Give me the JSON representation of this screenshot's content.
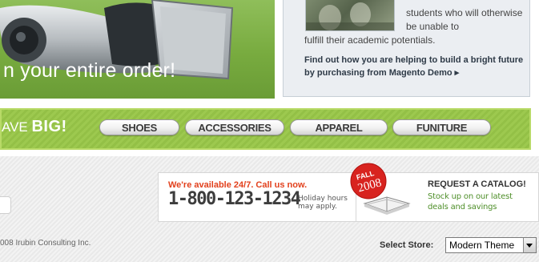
{
  "promo_left": {
    "headline": "n your entire order!"
  },
  "promo_right": {
    "desc_line1": "students who will otherwise be unable to",
    "desc_line2": "fulfill their academic potentials.",
    "cta": "Find out how you are helping to build a bright future by purchasing from Magento Demo ▸"
  },
  "nav": {
    "slogan_prefix": "AVE ",
    "slogan_big": "BIG!",
    "buttons": [
      {
        "label": "SHOES"
      },
      {
        "label": "ACCESSORIES"
      },
      {
        "label": "APPAREL"
      },
      {
        "label": "FUNITURE"
      }
    ]
  },
  "footer": {
    "availability": "We're available 24/7. Call us now.",
    "phone": "1-800-123-1234",
    "hours_note": "Holiday hours may apply.",
    "badge_top": "FALL",
    "badge_year": "2008",
    "catalog_title": "REQUEST A CATALOG!",
    "catalog_desc": "Stock up on our latest deals and savings",
    "copyright": "008 Irubin Consulting Inc.",
    "store_label": "Select Store:",
    "store_selected": "Modern Theme"
  },
  "colors": {
    "brand_green": "#8dbb4a",
    "accent_red": "#e2401c",
    "catalog_green": "#4f8f2a"
  }
}
